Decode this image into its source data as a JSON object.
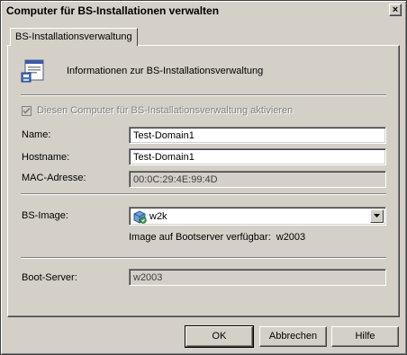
{
  "window": {
    "title": "Computer für BS-Installationen verwalten",
    "close_glyph": "×"
  },
  "tab": {
    "label": "BS-Installationsverwaltung"
  },
  "header": {
    "info_text": "Informationen zur BS-Installationsverwaltung",
    "icon": "document-window-icon"
  },
  "enable_checkbox": {
    "label": "Diesen Computer für BS-Installationsverwaltung aktivieren",
    "checked": true,
    "enabled": false
  },
  "fields": {
    "name": {
      "label": "Name:",
      "value": "Test-Domain1"
    },
    "hostname": {
      "label": "Hostname:",
      "value": "Test-Domain1"
    },
    "mac": {
      "label": "MAC-Adresse:",
      "value": "00:0C:29:4E:99:4D"
    }
  },
  "image": {
    "label": "BS-Image:",
    "selected": "w2k",
    "icon": "image-package-icon",
    "availability_label": "Image auf Bootserver verfügbar:",
    "availability_value": "w2003"
  },
  "boot_server": {
    "label": "Boot-Server:",
    "value": "w2003"
  },
  "buttons": {
    "ok": "OK",
    "cancel": "Abbrechen",
    "help": "Hilfe"
  }
}
